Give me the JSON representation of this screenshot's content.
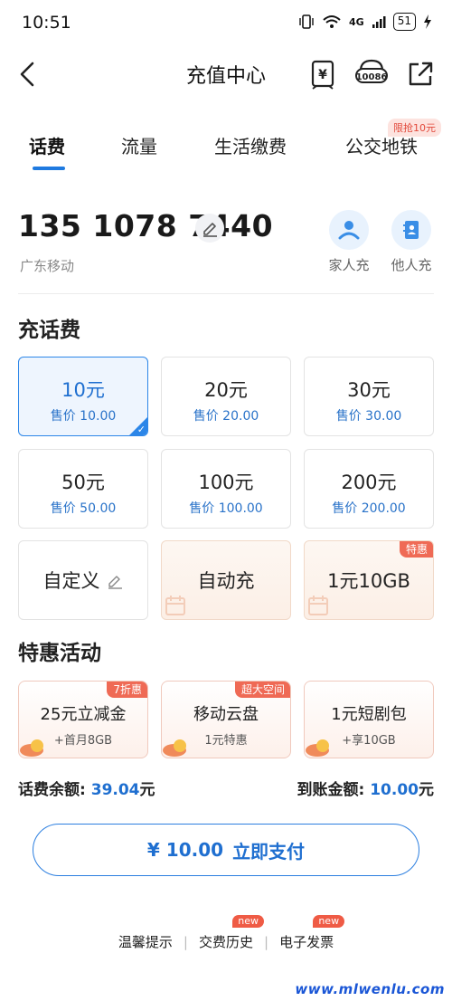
{
  "status_bar": {
    "time": "10:51",
    "network": "4G",
    "battery": "51"
  },
  "nav": {
    "title": "充值中心",
    "bill_icon_glyph": "¥",
    "service_number": "10086"
  },
  "tabs": [
    {
      "label": "话费",
      "active": true
    },
    {
      "label": "流量",
      "active": false
    },
    {
      "label": "生活缴费",
      "active": false
    },
    {
      "label": "公交地铁",
      "active": false
    }
  ],
  "tab_promo_badge": "限抢10元",
  "account": {
    "phone_number": "135 1078 7440",
    "carrier": "广东移动",
    "quick_actions": [
      {
        "label": "家人充",
        "icon": "family-icon"
      },
      {
        "label": "他人充",
        "icon": "contact-book-icon"
      }
    ]
  },
  "recharge": {
    "section_title": "充话费",
    "options": [
      {
        "amount": "10元",
        "price": "售价 10.00",
        "selected": true
      },
      {
        "amount": "20元",
        "price": "售价 20.00"
      },
      {
        "amount": "30元",
        "price": "售价 30.00"
      },
      {
        "amount": "50元",
        "price": "售价 50.00"
      },
      {
        "amount": "100元",
        "price": "售价 100.00"
      },
      {
        "amount": "200元",
        "price": "售价 200.00"
      }
    ],
    "custom_label": "自定义",
    "auto_label": "自动充",
    "data_pack_label": "1元10GB",
    "data_pack_tag": "特惠"
  },
  "promotions": {
    "section_title": "特惠活动",
    "items": [
      {
        "title": "25元立减金",
        "subtitle": "+首月8GB",
        "tag": "7折惠"
      },
      {
        "title": "移动云盘",
        "subtitle": "1元特惠",
        "tag": "超大空间"
      },
      {
        "title": "1元短剧包",
        "subtitle": "+享10GB",
        "tag": ""
      }
    ]
  },
  "balance": {
    "label": "话费余额:",
    "value": "39.04",
    "unit": "元",
    "arrival_label": "到账金额:",
    "arrival_value": "10.00",
    "arrival_unit": "元"
  },
  "pay_button": {
    "amount": "¥ 10.00",
    "label": "立即支付"
  },
  "footer": {
    "links": [
      {
        "label": "温馨提示",
        "badge": ""
      },
      {
        "label": "交费历史",
        "badge": "new"
      },
      {
        "label": "电子发票",
        "badge": "new"
      }
    ],
    "separator": "|"
  },
  "watermark": "www.mlwenlu.com",
  "colors": {
    "accent_blue": "#1f6fd0",
    "promo_red": "#ef6a55",
    "selected_bg": "#eef5fe"
  }
}
